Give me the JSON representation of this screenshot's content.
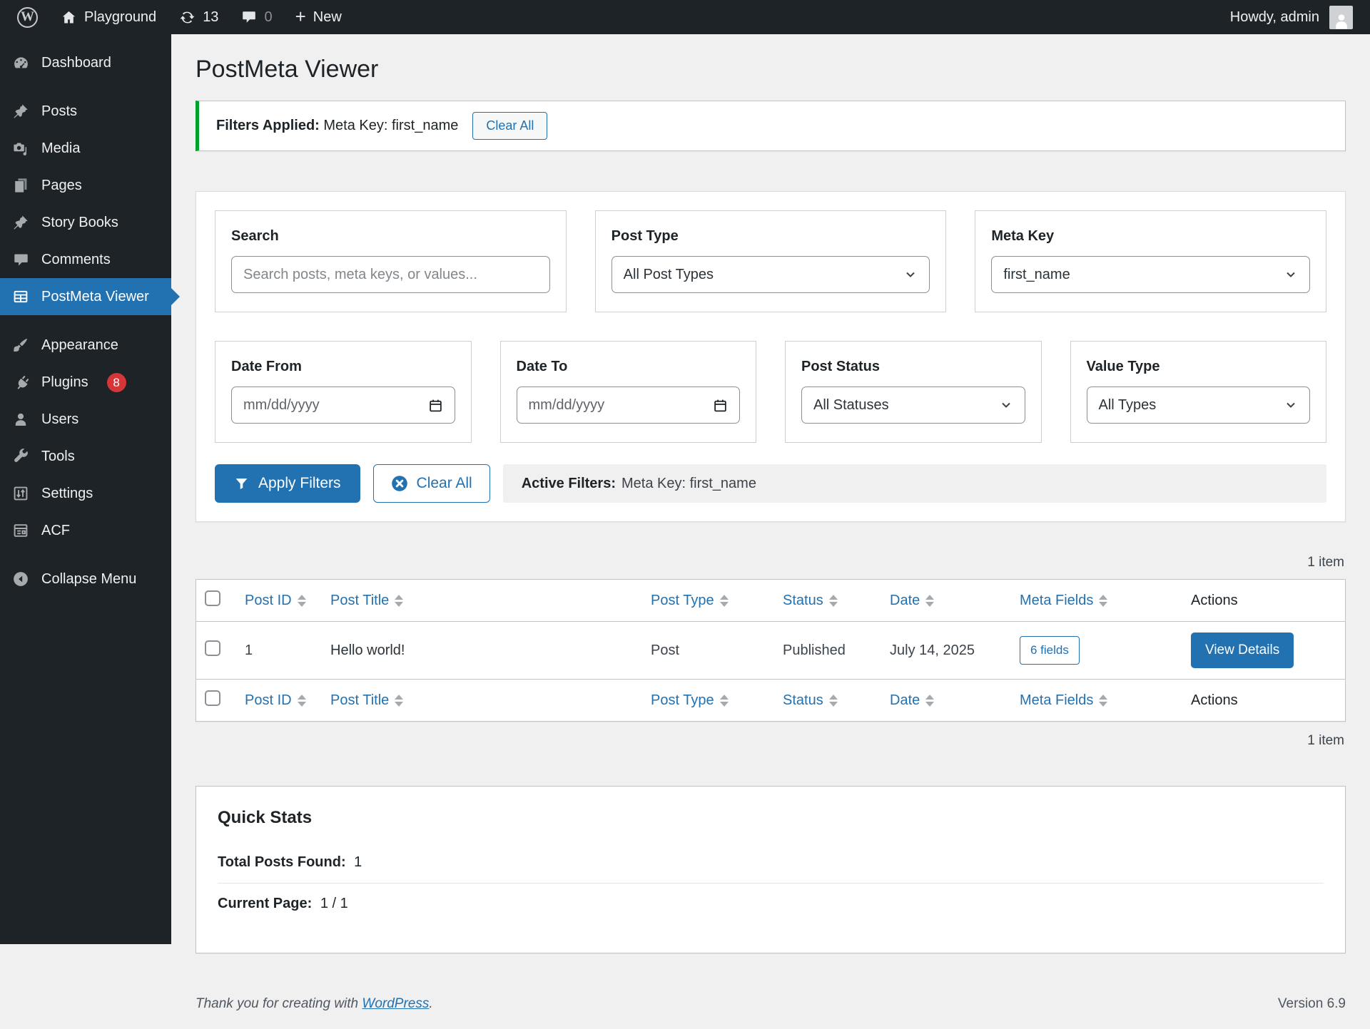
{
  "admin_bar": {
    "site_name": "Playground",
    "updates_count": "13",
    "comments_count": "0",
    "new_label": "New",
    "howdy": "Howdy, admin"
  },
  "sidebar": {
    "items": [
      {
        "label": "Dashboard"
      },
      {
        "label": "Posts"
      },
      {
        "label": "Media"
      },
      {
        "label": "Pages"
      },
      {
        "label": "Story Books"
      },
      {
        "label": "Comments"
      },
      {
        "label": "PostMeta Viewer"
      },
      {
        "label": "Appearance"
      },
      {
        "label": "Plugins",
        "badge": "8"
      },
      {
        "label": "Users"
      },
      {
        "label": "Tools"
      },
      {
        "label": "Settings"
      },
      {
        "label": "ACF"
      },
      {
        "label": "Collapse Menu"
      }
    ]
  },
  "page": {
    "title": "PostMeta Viewer"
  },
  "notice": {
    "label": "Filters Applied:",
    "text": "Meta Key: first_name",
    "clear_button": "Clear All"
  },
  "filters": {
    "search": {
      "label": "Search",
      "placeholder": "Search posts, meta keys, or values..."
    },
    "post_type": {
      "label": "Post Type",
      "value": "All Post Types"
    },
    "meta_key": {
      "label": "Meta Key",
      "value": "first_name"
    },
    "date_from": {
      "label": "Date From",
      "placeholder": "mm/dd/yyyy"
    },
    "date_to": {
      "label": "Date To",
      "placeholder": "mm/dd/yyyy"
    },
    "post_status": {
      "label": "Post Status",
      "value": "All Statuses"
    },
    "value_type": {
      "label": "Value Type",
      "value": "All Types"
    },
    "apply_button": "Apply Filters",
    "clear_button": "Clear All",
    "active_label": "Active Filters:",
    "active_text": "Meta Key: first_name"
  },
  "table": {
    "count_text": "1 item",
    "columns": [
      {
        "label": "Post ID"
      },
      {
        "label": "Post Title"
      },
      {
        "label": "Post Type"
      },
      {
        "label": "Status"
      },
      {
        "label": "Date"
      },
      {
        "label": "Meta Fields"
      },
      {
        "label": "Actions"
      }
    ],
    "rows": [
      {
        "id": "1",
        "title": "Hello world!",
        "type": "Post",
        "status": "Published",
        "date": "July 14, 2025",
        "meta_fields": "6 fields",
        "action": "View Details"
      }
    ]
  },
  "stats": {
    "title": "Quick Stats",
    "total_label": "Total Posts Found:",
    "total_value": "1",
    "page_label": "Current Page:",
    "page_value": "1 / 1"
  },
  "footer": {
    "thanks_text": "Thank you for creating with",
    "link_text": "WordPress",
    "period": ".",
    "version": "Version 6.9"
  },
  "colors": {
    "accent": "#2271b1",
    "notice_green": "#00a32a",
    "badge_red": "#d63638",
    "admin_dark": "#1d2327",
    "page_bg": "#f0f0f1"
  }
}
